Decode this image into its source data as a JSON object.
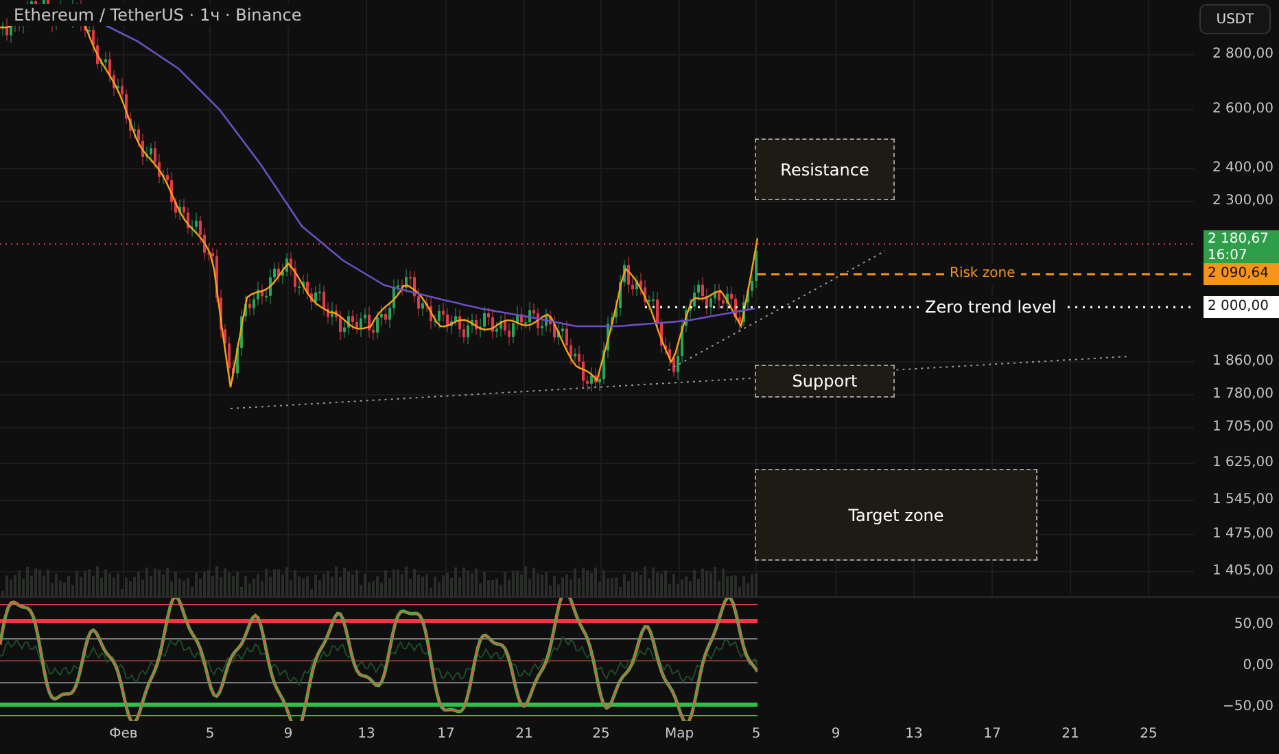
{
  "header": {
    "symbol_title": "Ethereum / TetherUS · 1ч · Binance"
  },
  "price_axis": {
    "currency_button": "USDT",
    "ticks": [
      "2 800,00",
      "2 600,00",
      "2 400,00",
      "2 300,00",
      "1 860,00",
      "1 780,00",
      "1 705,00",
      "1 625,00",
      "1 545,00",
      "1 475,00",
      "1 405,00"
    ],
    "last_price": "2 180,67",
    "countdown": "16:07"
  },
  "levels": [
    {
      "kind": "dashed",
      "label": "Risk zone",
      "price": "2 090,64",
      "color": "#f7931a"
    },
    {
      "kind": "dotted",
      "label": "Zero trend level",
      "price": "2 000,00",
      "color": "#ffffff"
    }
  ],
  "zones": [
    {
      "label": "Resistance"
    },
    {
      "label": "Support"
    },
    {
      "label": "Target zone"
    }
  ],
  "oscillator": {
    "ticks": [
      "50,00",
      "0,00",
      "−50,00"
    ]
  },
  "time_axis": {
    "ticks": [
      "Фев",
      "5",
      "9",
      "13",
      "17",
      "21",
      "25",
      "Мар",
      "5",
      "9",
      "13",
      "17",
      "21",
      "25"
    ]
  }
}
